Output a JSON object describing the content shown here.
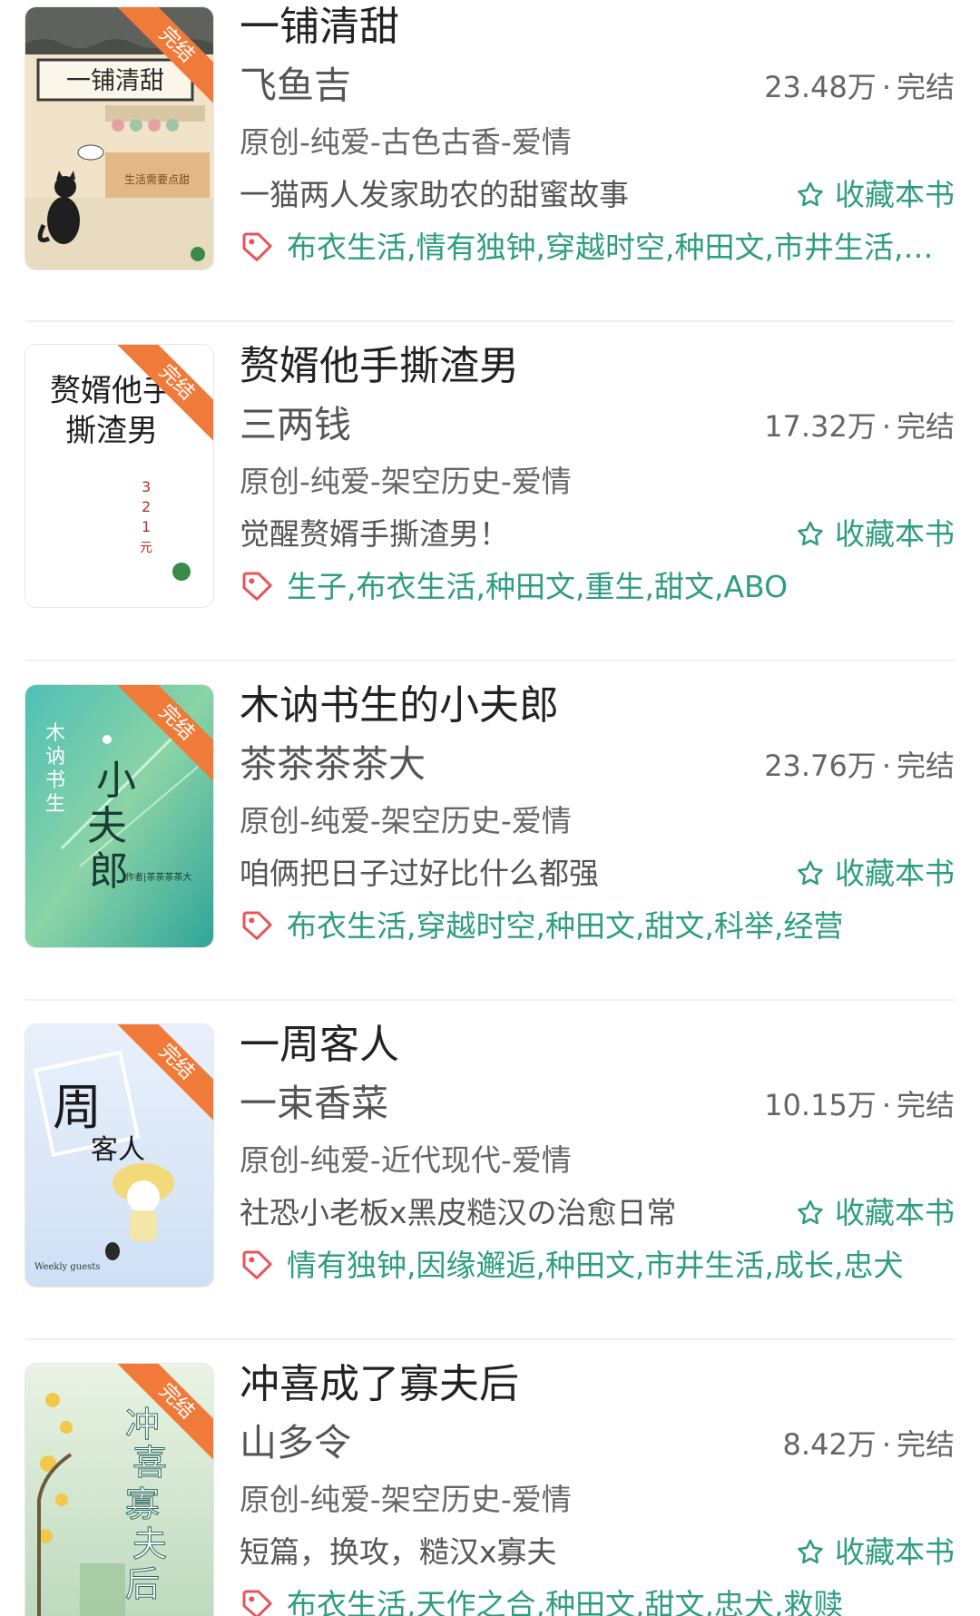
{
  "fav_label": "收藏本书",
  "badge_label": "完结",
  "colors": {
    "accent": "#2e9d80",
    "tag_icon": "#e8545a",
    "badge": "#f07a3a"
  },
  "books": [
    {
      "title": "一铺清甜",
      "author": "飞鱼吉",
      "count": "23.48万",
      "status": "完结",
      "category": "原创-纯爱-古色古香-爱情",
      "summary": "一猫两人发家助农的甜蜜故事",
      "tags": "布衣生活,情有独钟,穿越时空,种田文,市井生活,…",
      "cover_text": "一铺清甜"
    },
    {
      "title": "赘婿他手撕渣男",
      "author": "三两钱",
      "count": "17.32万",
      "status": "完结",
      "category": "原创-纯爱-架空历史-爱情",
      "summary": "觉醒赘婿手撕渣男！",
      "tags": "生子,布衣生活,种田文,重生,甜文,ABO",
      "cover_text": "赘婿他手撕渣男"
    },
    {
      "title": "木讷书生的小夫郎",
      "author": "茶茶茶茶大",
      "count": "23.76万",
      "status": "完结",
      "category": "原创-纯爱-架空历史-爱情",
      "summary": "咱俩把日子过好比什么都强",
      "tags": "布衣生活,穿越时空,种田文,甜文,科举,经营",
      "cover_text": "木讷书生的小夫郎"
    },
    {
      "title": "一周客人",
      "author": "一束香菜",
      "count": "10.15万",
      "status": "完结",
      "category": "原创-纯爱-近代现代-爱情",
      "summary": "社恐小老板x黑皮糙汉の治愈日常",
      "tags": "情有独钟,因缘邂逅,种田文,市井生活,成长,忠犬",
      "cover_text": "周客人"
    },
    {
      "title": "冲喜成了寡夫后",
      "author": "山多令",
      "count": "8.42万",
      "status": "完结",
      "category": "原创-纯爱-架空历史-爱情",
      "summary": "短篇，换攻，糙汉x寡夫",
      "tags": "布衣生活,天作之合,种田文,甜文,忠犬,救赎",
      "cover_text": "冲喜成了寡夫后"
    }
  ]
}
